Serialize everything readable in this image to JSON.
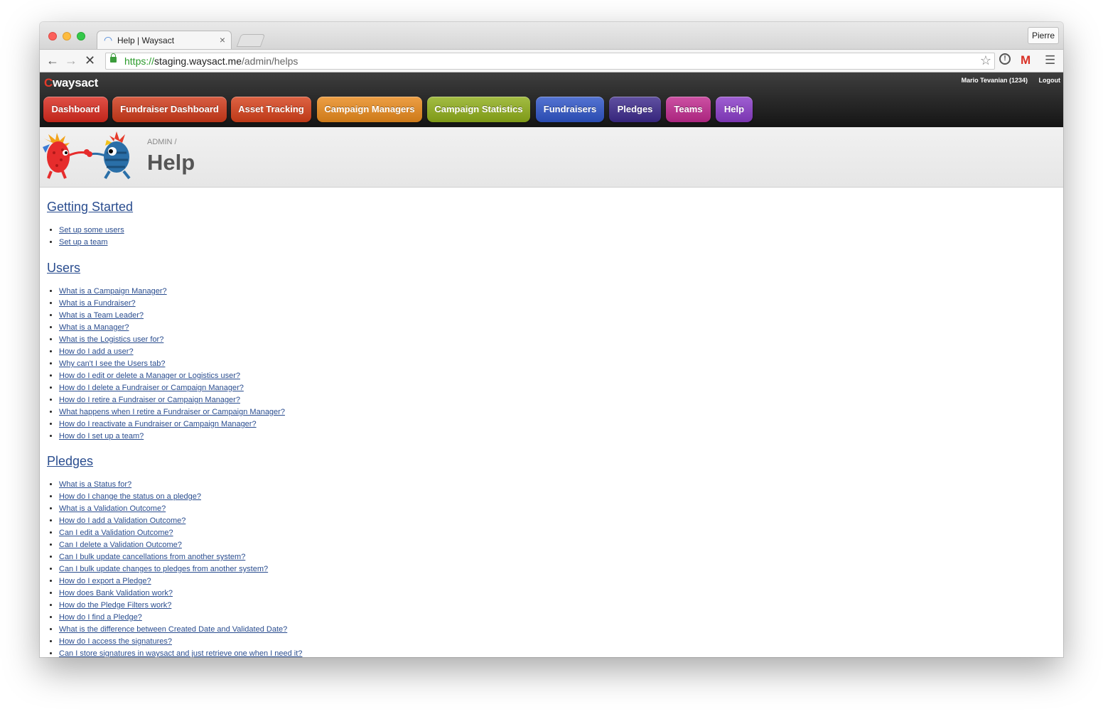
{
  "browser": {
    "tab_title": "Help | Waysact",
    "profile_name": "Pierre",
    "url_scheme": "https://",
    "url_host": "staging.waysact.me",
    "url_path": "/admin/helps"
  },
  "site": {
    "logo_c": "C",
    "logo_text": "waysact",
    "user_label": "Mario Tevanian (1234)",
    "logout_label": "Logout"
  },
  "nav": {
    "items": [
      {
        "label": "Dashboard",
        "color": "#d92a1e"
      },
      {
        "label": "Fundraiser Dashboard",
        "color": "#cf3a1a"
      },
      {
        "label": "Asset Tracking",
        "color": "#d6401a"
      },
      {
        "label": "Campaign Managers",
        "color": "#e98a1c"
      },
      {
        "label": "Campaign Statistics",
        "color": "#8fae1a"
      },
      {
        "label": "Fundraisers",
        "color": "#2f55c8"
      },
      {
        "label": "Pledges",
        "color": "#3d2a8c"
      },
      {
        "label": "Teams",
        "color": "#c12a8f"
      },
      {
        "label": "Help",
        "color": "#8a3cc8"
      }
    ]
  },
  "page": {
    "breadcrumb": "ADMIN /",
    "title": "Help"
  },
  "sections": [
    {
      "title": "Getting Started",
      "links": [
        "Set up some users",
        "Set up a team"
      ]
    },
    {
      "title": "Users",
      "links": [
        "What is a Campaign Manager?",
        "What is a Fundraiser?",
        "What is a Team Leader?",
        "What is a Manager?",
        "What is the Logistics user for?",
        "How do I add a user?",
        "Why can't I see the Users tab?",
        "How do I edit or delete a Manager or Logistics user?",
        "How do I delete a Fundraiser or Campaign Manager?",
        "How do I retire a Fundraiser or Campaign Manager?",
        "What happens when I retire a Fundraiser or Campaign Manager?",
        "How do I reactivate a Fundraiser or Campaign Manager?",
        "How do I set up a team?"
      ]
    },
    {
      "title": "Pledges",
      "links": [
        "What is a Status for?",
        "How do I change the status on a pledge?",
        "What is a Validation Outcome?",
        "How do I add a Validation Outcome?",
        "Can I edit a Validation Outcome?",
        "Can I delete a Validation Outcome?",
        "Can I bulk update cancellations from another system?",
        "Can I bulk update changes to pledges from another system?",
        "How do I export a Pledge?",
        "How does Bank Validation work?",
        "How do the Pledge Filters work?",
        "How do I find a Pledge?",
        "What is the difference between Created Date and Validated Date?",
        "How do I access the signatures?",
        "Can I store signatures in waysact and just retrieve one when I need it?"
      ]
    }
  ]
}
